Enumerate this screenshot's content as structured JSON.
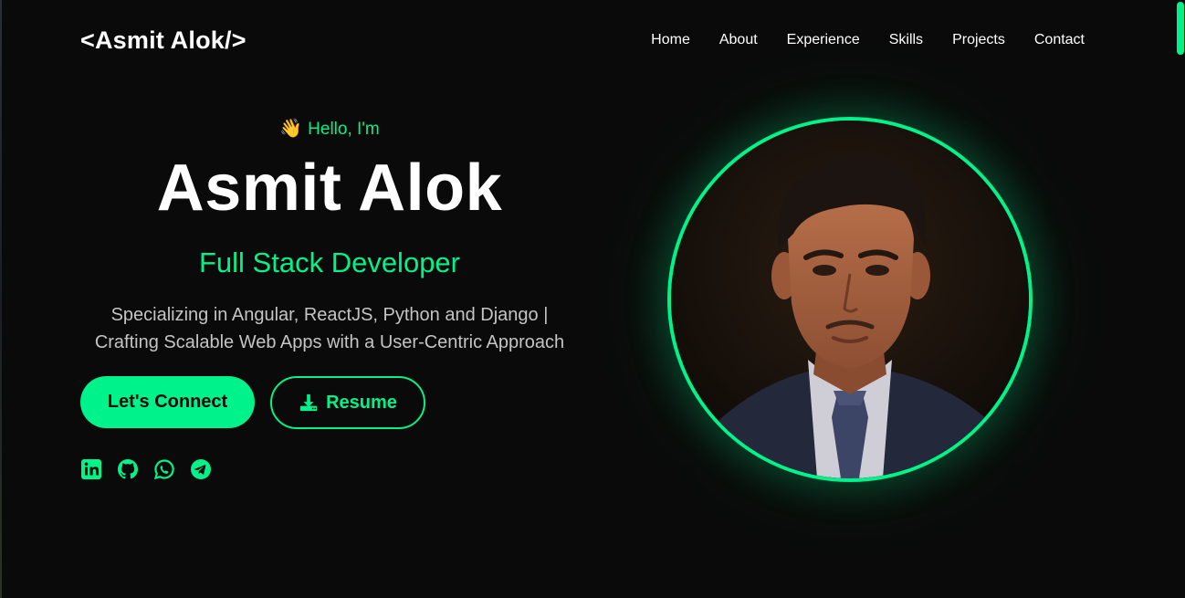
{
  "header": {
    "logo": "<Asmit Alok/>",
    "nav": [
      "Home",
      "About",
      "Experience",
      "Skills",
      "Projects",
      "Contact"
    ]
  },
  "hero": {
    "greeting": "Hello, I'm",
    "greeting_emoji": "👋",
    "name": "Asmit Alok",
    "role": "Full Stack Developer",
    "tagline_line1": "Specializing in Angular, ReactJS, Python and Django |",
    "tagline_line2": "Crafting Scalable Web Apps with a User-Centric Approach"
  },
  "buttons": {
    "connect_label": "Let's Connect",
    "resume_label": "Resume",
    "resume_icon": "download-icon"
  },
  "socials": [
    "linkedin-icon",
    "github-icon",
    "whatsapp-icon",
    "telegram-icon"
  ],
  "colors": {
    "accent": "#00f28a",
    "background": "#0a0a0a",
    "text": "#ffffff",
    "muted_text": "#c4c4c4"
  }
}
